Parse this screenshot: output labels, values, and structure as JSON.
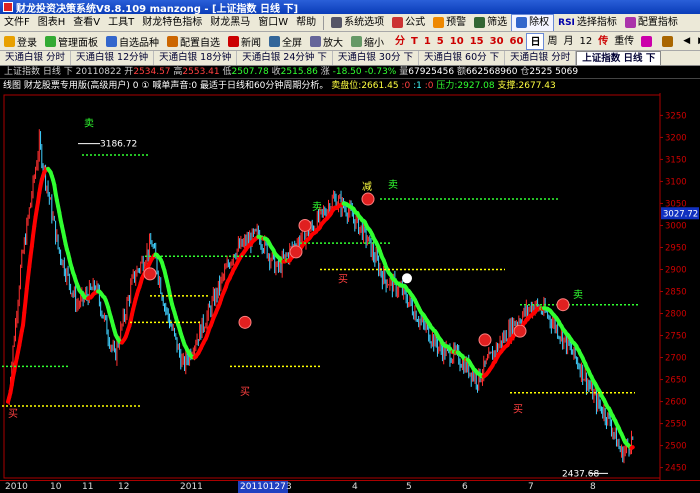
{
  "window": {
    "title": "财龙投资决策系统V8.8.109 manzong - [上证指数 日线 下]"
  },
  "menu": {
    "items": [
      "文件F",
      "图表H",
      "查看V",
      "工具T",
      "财龙特色指标",
      "财龙黑马",
      "窗口W",
      "帮助"
    ],
    "right_items": [
      "系统选项",
      "公式",
      "预警",
      "筛选",
      "除权",
      "选择指标",
      "配置指标"
    ],
    "rsi_badge": "RSI"
  },
  "toolbar": {
    "buttons": [
      "登录",
      "管理面板",
      "自选品种",
      "配置自选",
      "新闻",
      "全屏",
      "放大",
      "缩小"
    ],
    "periods": [
      "分",
      "T",
      "1",
      "5",
      "10",
      "15",
      "30",
      "60",
      "日",
      "周",
      "月",
      "12",
      "传",
      "重传"
    ],
    "active_period": "日"
  },
  "tabs": {
    "items": [
      "天通白银 分时",
      "天通白银 12分钟",
      "天通白银 18分钟",
      "天通白银 24分钟 下",
      "天通白银 30分 下",
      "天通白银 60分 下",
      "天通白银 分时",
      "上证指数 日线 下"
    ],
    "active": "上证指数 日线 下"
  },
  "quote": {
    "name": "上证指数 日线 下",
    "date": "20110822",
    "open_label": "开",
    "open": "2534.57",
    "high_label": "高",
    "high": "2553.41",
    "low_label": "低",
    "low": "2507.78",
    "close_label": "收",
    "close": "2515.86",
    "change_label": "涨",
    "change": "-18.50",
    "change_pct": "-0.73%",
    "volume_label": "量",
    "volume": "67925456",
    "amount_label": "额",
    "amount": "662568960",
    "position_label": "仓",
    "position": "2525",
    "extra": "5069"
  },
  "indicator": {
    "prefix": "线图",
    "name": "财龙股票专用版(高级用户)",
    "controls": "0 ①",
    "desc": "喊单声音:0 最适于日线和60分钟周期分析。",
    "support_pressure_label": "卖盘位:",
    "sp_value": "2661.45",
    "a": ":0",
    "b": ":1",
    "c": ":0",
    "pressure_label": "压力:",
    "pressure": "2927.08",
    "support_label": "支撑:",
    "support": "2677.43"
  },
  "chart_data": {
    "type": "candlestick",
    "yaxis_ticks": [
      "3250",
      "3200",
      "3150",
      "3100",
      "3050",
      "3000",
      "2950",
      "2900",
      "2850",
      "2800",
      "2750",
      "2700",
      "2650",
      "2600",
      "2550",
      "2500",
      "2450"
    ],
    "ylim": [
      2440,
      3260
    ],
    "current_price": "3027.72",
    "annotations": {
      "peak_label": "3186.72",
      "trough_label": "2437.68",
      "sell": "卖",
      "buy": "买",
      "reduce": "减"
    },
    "xaxis_ticks": [
      "2010",
      "10",
      "11",
      "12",
      "2011",
      "20110127",
      "3",
      "4",
      "5",
      "6",
      "7",
      "8"
    ],
    "highlighted_tick": "20110127",
    "colors": {
      "up": "#ff3030",
      "down": "#40d0ff",
      "ma_up": "#ff0000",
      "ma_down": "#30ff30",
      "support": "#ffff00",
      "pressure": "#30ff30"
    }
  }
}
